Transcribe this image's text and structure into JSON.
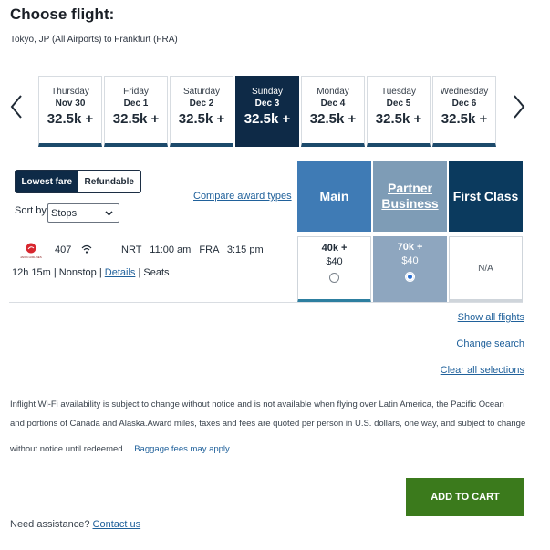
{
  "header": {
    "title": "Choose flight:",
    "route": "Tokyo, JP (All Airports) to Frankfurt (FRA)"
  },
  "dates": [
    {
      "dow": "Thursday",
      "date": "Nov 30",
      "price": "32.5k +",
      "selected": false
    },
    {
      "dow": "Friday",
      "date": "Dec 1",
      "price": "32.5k +",
      "selected": false
    },
    {
      "dow": "Saturday",
      "date": "Dec 2",
      "price": "32.5k +",
      "selected": false
    },
    {
      "dow": "Sunday",
      "date": "Dec 3",
      "price": "32.5k +",
      "selected": true
    },
    {
      "dow": "Monday",
      "date": "Dec 4",
      "price": "32.5k +",
      "selected": false
    },
    {
      "dow": "Tuesday",
      "date": "Dec 5",
      "price": "32.5k +",
      "selected": false
    },
    {
      "dow": "Wednesday",
      "date": "Dec 6",
      "price": "32.5k +",
      "selected": false
    }
  ],
  "filters": {
    "lowest_fare": "Lowest fare",
    "refundable": "Refundable",
    "sort_label": "Sort by",
    "sort_value": "Stops",
    "compare_link": "Compare award types"
  },
  "cabins": {
    "main": "Main",
    "partner_line1": "Partner",
    "partner_line2": "Business",
    "first": "First Class"
  },
  "flight": {
    "airline_logo_text": "JAPAN AIRLINES",
    "number": "407",
    "origin": "NRT",
    "depart": "11:00 am",
    "destination": "FRA",
    "arrive": "3:15 pm",
    "duration": "12h 15m",
    "stops": "Nonstop",
    "details": "Details",
    "seats": "Seats",
    "fares": {
      "main": {
        "miles": "40k +",
        "fee": "$40"
      },
      "partner": {
        "miles": "70k +",
        "fee": "$40"
      },
      "first": {
        "na": "N/A"
      }
    }
  },
  "links": {
    "show_all": "Show all flights",
    "change_search": "Change search",
    "clear": "Clear all selections"
  },
  "notes": {
    "line1": "Inflight Wi-Fi availability is subject to change without notice and is not available when flying over Latin America, the Pacific Ocean",
    "line2": "and portions of Canada and Alaska.Award miles, taxes and fees are quoted per person in U.S. dollars, one way, and subject to change",
    "line3": "without notice until redeemed.",
    "baggage_link": "Baggage fees may apply"
  },
  "cart": {
    "label": "ADD TO CART"
  },
  "assist": {
    "text": "Need assistance?",
    "contact": "Contact us"
  },
  "colors": {
    "selected_date": "#0e2a47",
    "main_cabin": "#3f7bb5",
    "partner_cabin": "#7e9cb6",
    "first_cabin": "#0b3a5e",
    "cart_button": "#3b7a1c",
    "link": "#20619b"
  }
}
